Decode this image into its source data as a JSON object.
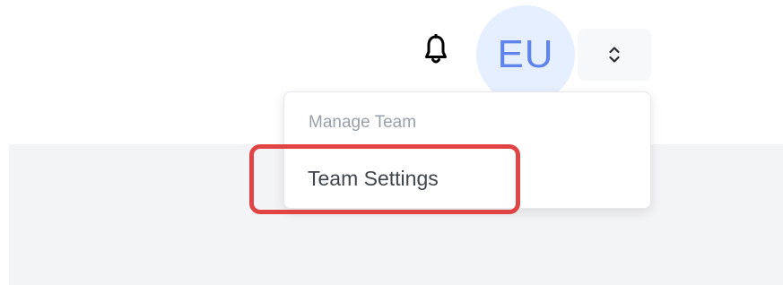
{
  "header": {
    "notification_icon": "bell-icon",
    "avatar_initials": "EU",
    "avatar_color": "#5f84ec",
    "toggle_icon": "chevron-up-down-icon"
  },
  "dropdown": {
    "section_header": "Manage Team",
    "items": [
      {
        "label": "Team Settings"
      }
    ]
  },
  "annotation": {
    "highlight_color": "#e04444"
  }
}
